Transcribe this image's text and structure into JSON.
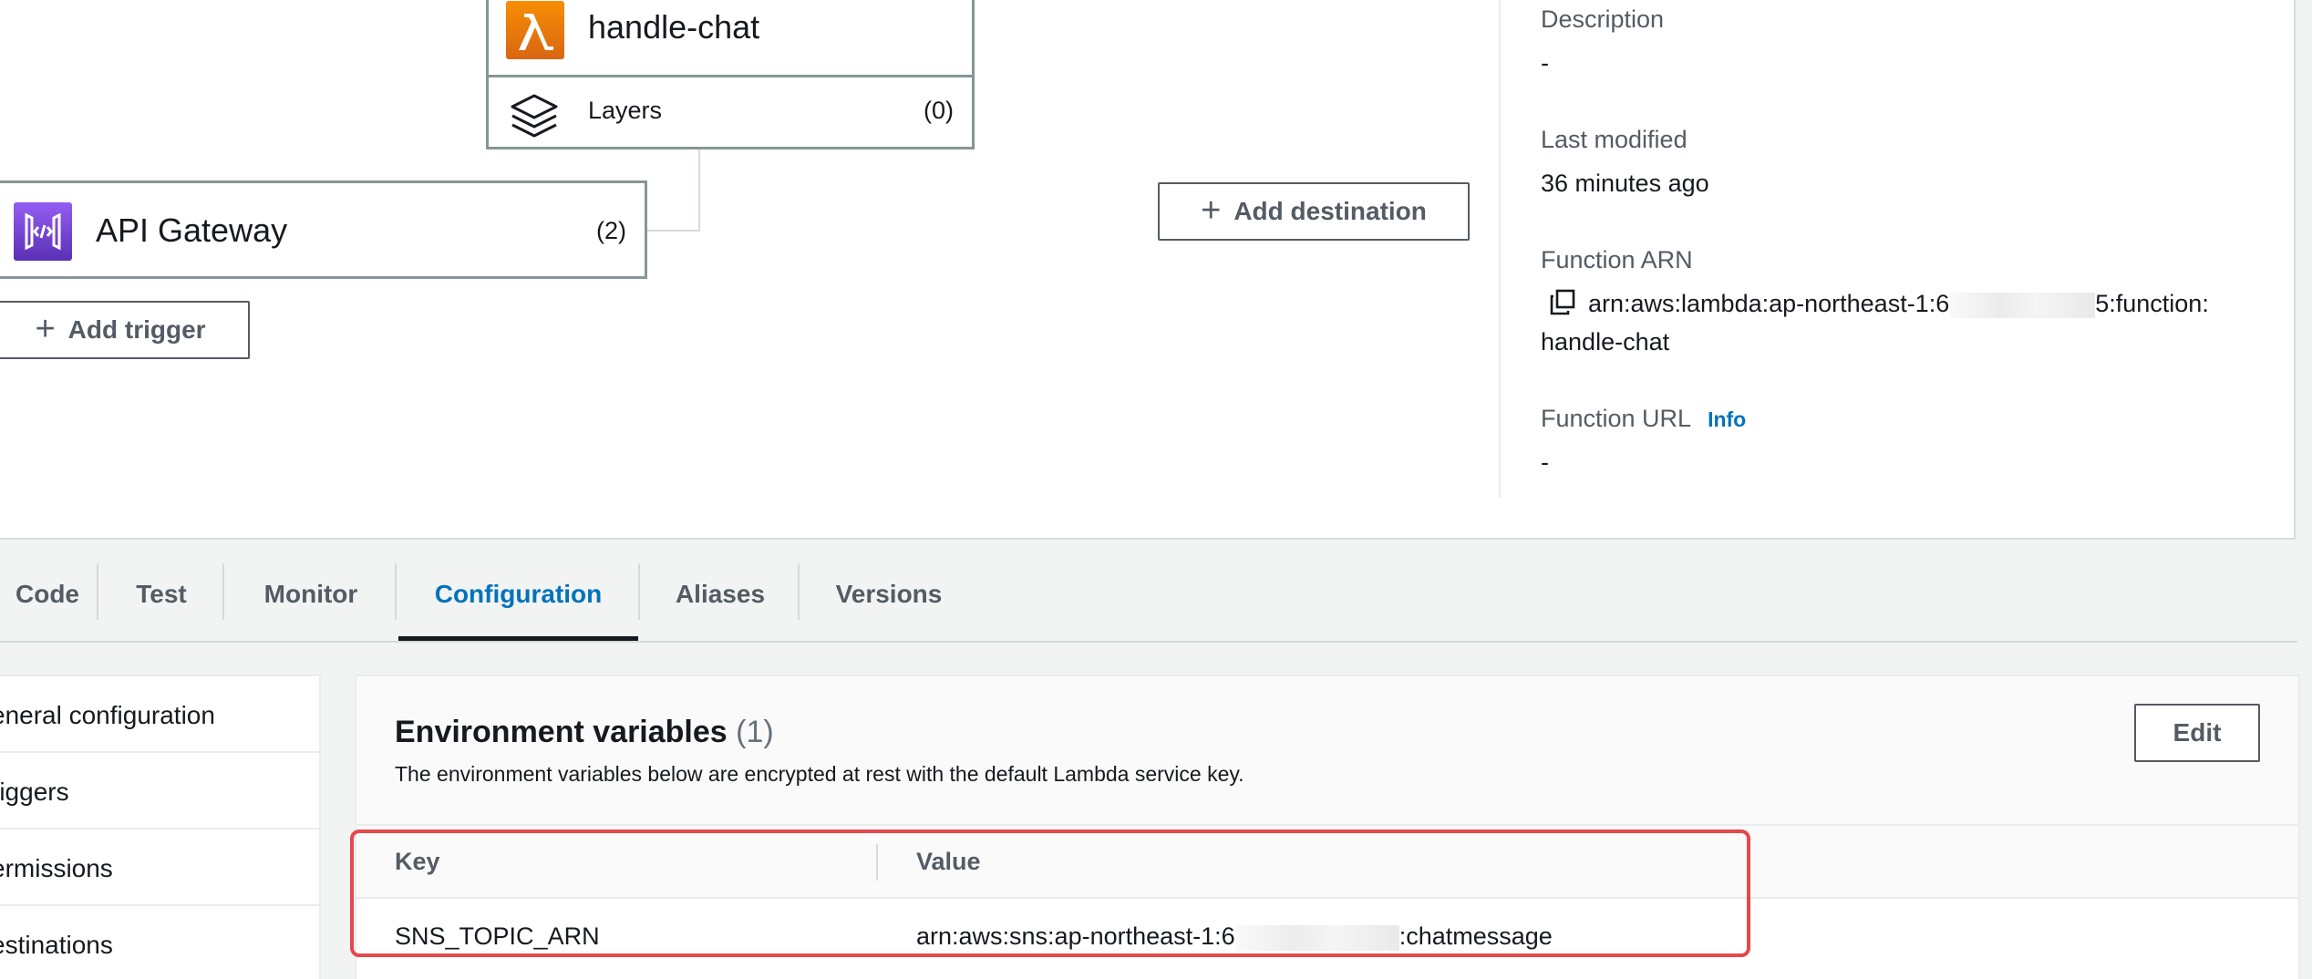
{
  "designer": {
    "function_name": "handle-chat",
    "layers_label": "Layers",
    "layers_count": "(0)",
    "trigger_name": "API Gateway",
    "trigger_count": "(2)",
    "add_trigger_label": "Add trigger",
    "add_destination_label": "Add destination"
  },
  "details": {
    "description_label": "Description",
    "description_value": "-",
    "last_modified_label": "Last modified",
    "last_modified_value": "36 minutes ago",
    "arn_label": "Function ARN",
    "arn_prefix": "arn:aws:lambda:ap-northeast-1:6",
    "arn_suffix": "5:function:",
    "arn_line2": "handle-chat",
    "url_label": "Function URL",
    "url_info": "Info",
    "url_value": "-"
  },
  "tabs": [
    {
      "label": "Code"
    },
    {
      "label": "Test"
    },
    {
      "label": "Monitor"
    },
    {
      "label": "Configuration"
    },
    {
      "label": "Aliases"
    },
    {
      "label": "Versions"
    }
  ],
  "active_tab": "Configuration",
  "config_nav": [
    {
      "label": "eneral configuration"
    },
    {
      "label": "riggers"
    },
    {
      "label": "ermissions"
    },
    {
      "label": "estinations"
    }
  ],
  "env": {
    "title": "Environment variables",
    "count": "(1)",
    "description": "The environment variables below are encrypted at rest with the default Lambda service key.",
    "edit_label": "Edit",
    "columns": {
      "key": "Key",
      "value": "Value"
    },
    "rows": [
      {
        "key": "SNS_TOPIC_ARN",
        "value_prefix": "arn:aws:sns:ap-northeast-1:6",
        "value_suffix": ":chatmessage"
      }
    ]
  },
  "colors": {
    "accent": "#0073bb",
    "lambda_orange": "#d86613",
    "api_gateway_purple": "#5a30b5",
    "highlight_red": "#e5484d"
  }
}
